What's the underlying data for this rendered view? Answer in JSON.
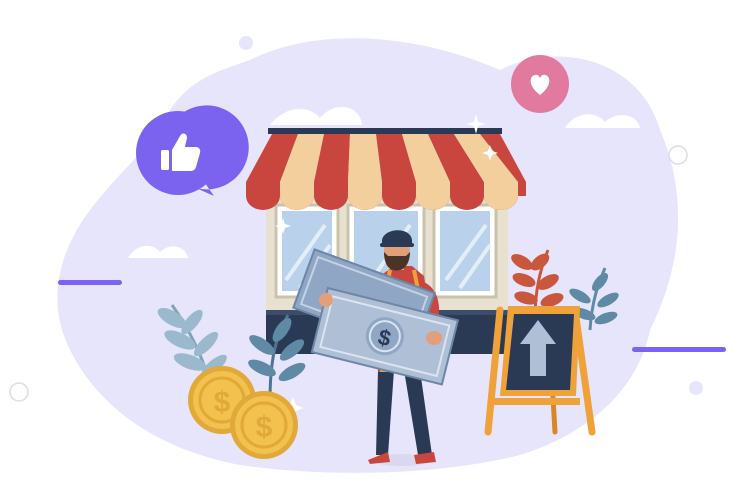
{
  "illustration": {
    "subject": "small-business-storefront",
    "icons": [
      "thumbs-up-icon",
      "heart-icon",
      "dollar-coin-icon",
      "dollar-bill-icon",
      "up-arrow-icon",
      "sparkle-icon"
    ],
    "colors": {
      "blob": "#e6e5fb",
      "purple": "#7b63f0",
      "pink": "#e27aa0",
      "awning_red": "#c9463f",
      "awning_cream": "#f2cf9c",
      "navy": "#2a3a55",
      "coin_gold": "#f2c14e",
      "bill_blue": "#aebfd6",
      "easel_orange": "#f0a23a",
      "leaf_teal": "#5f8aa5",
      "leaf_red": "#c9573e"
    }
  }
}
